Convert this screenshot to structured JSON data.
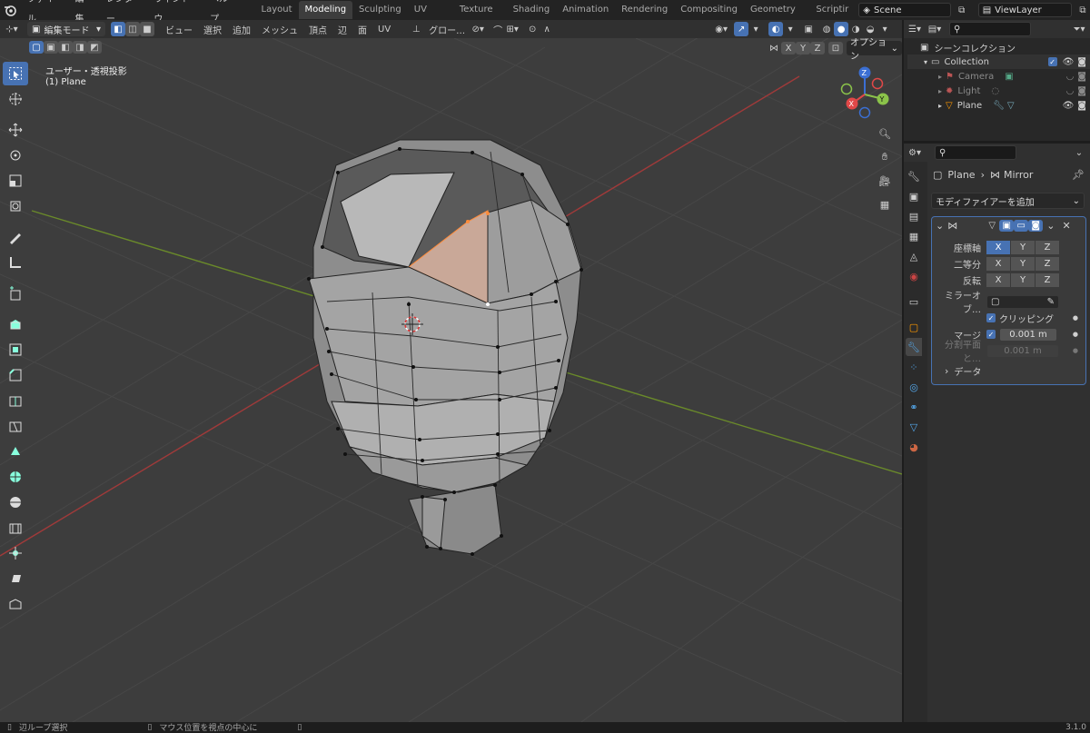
{
  "menu": [
    "ファイル",
    "編集",
    "レンダー",
    "ウィンドウ",
    "ヘルプ"
  ],
  "workspaces": [
    "Layout",
    "Modeling",
    "Sculpting",
    "UV Editing",
    "Texture Paint",
    "Shading",
    "Animation",
    "Rendering",
    "Compositing",
    "Geometry Nodes",
    "Scriptir"
  ],
  "active_workspace": "Modeling",
  "scene": "Scene",
  "view_layer": "ViewLayer",
  "header": {
    "mode": "編集モード",
    "menus": [
      "ビュー",
      "選択",
      "追加",
      "メッシュ",
      "頂点",
      "辺",
      "面",
      "UV"
    ],
    "transform": "グロー…",
    "options": "オプション",
    "axes": [
      "X",
      "Y",
      "Z"
    ]
  },
  "viewport": {
    "view_name": "ユーザー・透視投影",
    "object_name": "(1) Plane",
    "gizmo": {
      "x": "X",
      "y": "Y",
      "z": "Z"
    }
  },
  "outliner": {
    "title": "シーンコレクション",
    "items": [
      {
        "name": "Collection",
        "level": 0
      },
      {
        "name": "Camera",
        "level": 1
      },
      {
        "name": "Light",
        "level": 1
      },
      {
        "name": "Plane",
        "level": 1
      }
    ]
  },
  "properties": {
    "breadcrumb_object": "Plane",
    "breadcrumb_modifier": "Mirror",
    "add_modifier": "モディファイアーを追加",
    "axis_label": "座標軸",
    "bisect_label": "二等分",
    "flip_label": "反転",
    "mirror_object_label": "ミラーオブ…",
    "clipping_label": "クリッピング",
    "merge_label": "マージ",
    "merge_value": "0.001 m",
    "bisect_dist_label": "分割平面と…",
    "bisect_dist_value": "0.001 m",
    "data_label": "データ",
    "x": "X",
    "y": "Y",
    "z": "Z"
  },
  "status": {
    "left": "辺ループ選択",
    "middle": "マウス位置を視点の中心に",
    "version": "3.1.0"
  },
  "colors": {
    "accent": "#4772b3",
    "selected_edge": "#ff8c3b"
  }
}
